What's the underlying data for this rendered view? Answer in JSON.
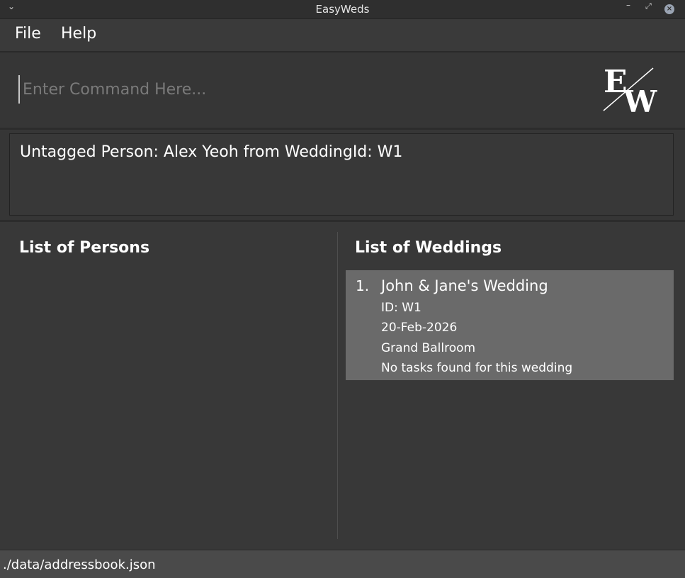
{
  "window": {
    "title": "EasyWeds",
    "controls": {
      "minimize_icon": "–",
      "maximize_icon": "⤢",
      "close_icon": "×"
    }
  },
  "menu": {
    "file": "File",
    "help": "Help"
  },
  "command": {
    "placeholder": "Enter Command Here...",
    "value": ""
  },
  "logo": {
    "letters": "EW"
  },
  "result": {
    "text": "Untagged Person: Alex Yeoh from WeddingId: W1"
  },
  "persons_panel": {
    "title": "List of Persons",
    "items": []
  },
  "weddings_panel": {
    "title": "List of Weddings",
    "items": [
      {
        "index": "1.",
        "name": "John & Jane's Wedding",
        "id": "ID: W1",
        "date": "20-Feb-2026",
        "venue": "Grand Ballroom",
        "tasks": "No tasks found for this wedding"
      }
    ]
  },
  "status": {
    "file_path": "./data/addressbook.json"
  },
  "colors": {
    "background": "#383838",
    "card": "#6a6a6a",
    "status_bar": "#4a4a4a"
  }
}
